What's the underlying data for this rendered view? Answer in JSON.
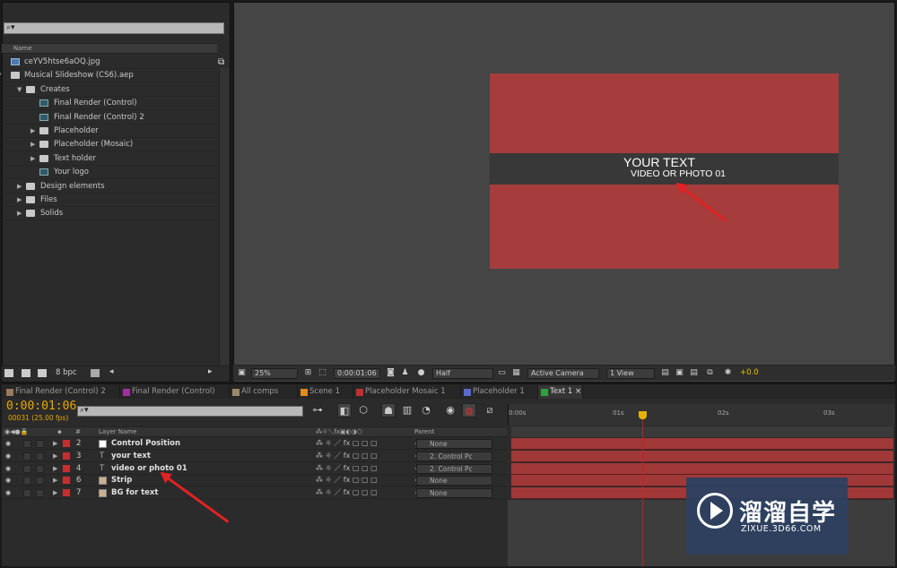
{
  "project": {
    "search_placeholder": "",
    "column_name": "Name",
    "items": [
      {
        "label": "ceYV5htse6aOQ.jpg",
        "type": "image",
        "indent": 0
      },
      {
        "label": "Musical Slideshow (CS6).aep",
        "type": "folder",
        "indent": 0,
        "open": true
      },
      {
        "label": "Creates",
        "type": "folder",
        "indent": 1,
        "open": true
      },
      {
        "label": "Final Render (Control)",
        "type": "comp",
        "indent": 2
      },
      {
        "label": "Final Render (Control) 2",
        "type": "comp",
        "indent": 2
      },
      {
        "label": "Placeholder",
        "type": "folder",
        "indent": 2
      },
      {
        "label": "Placeholder (Mosaic)",
        "type": "folder",
        "indent": 2
      },
      {
        "label": "Text holder",
        "type": "folder",
        "indent": 2
      },
      {
        "label": "Your logo",
        "type": "comp",
        "indent": 2
      },
      {
        "label": "Design elements",
        "type": "folder",
        "indent": 1
      },
      {
        "label": "Files",
        "type": "folder",
        "indent": 1
      },
      {
        "label": "Solids",
        "type": "folder",
        "indent": 1
      }
    ],
    "bpc": "8 bpc"
  },
  "viewer": {
    "line1": "YOUR TEXT",
    "line2": "VIDEO OR PHOTO 01",
    "zoom": "25%",
    "timecode": "0:00:01:06",
    "resolution": "Half",
    "camera": "Active Camera",
    "views": "1 View",
    "exposure": "+0.0"
  },
  "tabs": [
    {
      "label": "Final Render (Control) 2",
      "color": "#9a7a5a",
      "active": false
    },
    {
      "label": "Final Render (Control)",
      "color": "#a030a0",
      "active": false
    },
    {
      "label": "All comps",
      "color": "#9a8a6a",
      "active": false
    },
    {
      "label": "Scene 1",
      "color": "#e08a20",
      "active": false
    },
    {
      "label": "Placeholder Mosaic 1",
      "color": "#c03030",
      "active": false
    },
    {
      "label": "Placeholder 1",
      "color": "#5a6ad0",
      "active": false
    },
    {
      "label": "Text 1",
      "color": "#30a040",
      "active": true
    }
  ],
  "timeline": {
    "timecode": "0:00:01:06",
    "frames": "00031 (25.00 fps)",
    "col_hash": "#",
    "col_layer_name": "Layer Name",
    "col_parent": "Parent",
    "ruler": [
      "0:00s",
      "01s",
      "02s",
      "03s"
    ],
    "layers": [
      {
        "num": "2",
        "name": "Control Position",
        "type": "solid",
        "swatch": "#ffffff",
        "parent": "None"
      },
      {
        "num": "3",
        "name": "your text",
        "type": "text",
        "parent": "2. Control Pc"
      },
      {
        "num": "4",
        "name": "video or photo 01",
        "type": "text",
        "parent": "2. Control Pc"
      },
      {
        "num": "6",
        "name": "Strip",
        "type": "solid",
        "swatch": "#c8b090",
        "parent": "None"
      },
      {
        "num": "7",
        "name": "BG for text",
        "type": "solid",
        "swatch": "#c8b090",
        "parent": "None"
      }
    ]
  },
  "watermark": {
    "cn": "溜溜自学",
    "url": "ZIXUE.3D66.COM"
  }
}
